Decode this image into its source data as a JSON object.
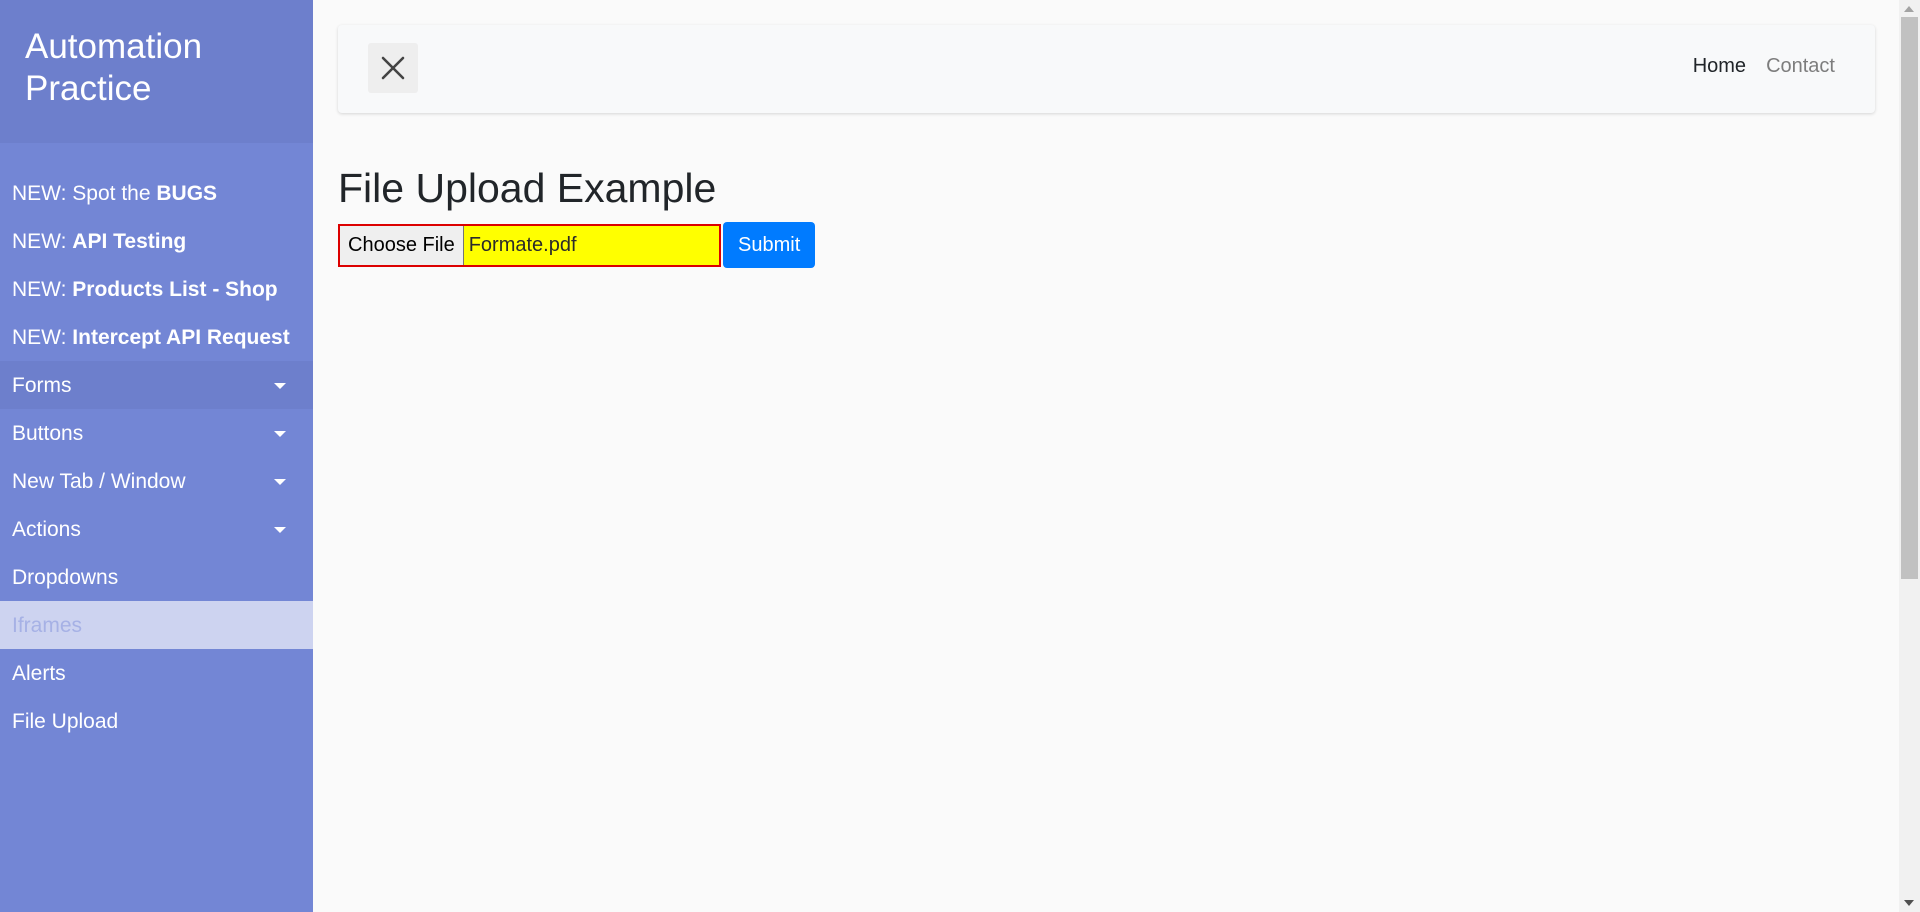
{
  "sidebar": {
    "brand": "Automation Practice",
    "items": [
      {
        "prefix": "NEW: Spot the ",
        "bold": "BUGS"
      },
      {
        "prefix": "NEW: ",
        "bold": "API Testing"
      },
      {
        "prefix": "NEW: ",
        "bold": "Products List - Shop"
      },
      {
        "prefix": "NEW: ",
        "bold": "Intercept API Request"
      },
      {
        "label": "Forms"
      },
      {
        "label": "Buttons"
      },
      {
        "label": "New Tab / Window"
      },
      {
        "label": "Actions"
      },
      {
        "label": "Dropdowns"
      },
      {
        "label": "Iframes"
      },
      {
        "label": "Alerts"
      },
      {
        "label": "File Upload"
      }
    ]
  },
  "navbar": {
    "home": "Home",
    "contact": "Contact",
    "toggle_icon": "close-icon"
  },
  "main": {
    "title": "File Upload Example",
    "choose_file_label": "Choose File",
    "file_name": "Formate.pdf",
    "submit_label": "Submit"
  },
  "colors": {
    "sidebar_bg": "#7386d5",
    "sidebar_header_bg": "#6d7fcc",
    "active_item_bg": "#cdd3f0",
    "submit_bg": "#007bff",
    "file_input_bg": "#ffff00",
    "file_input_border": "#dc0000"
  }
}
